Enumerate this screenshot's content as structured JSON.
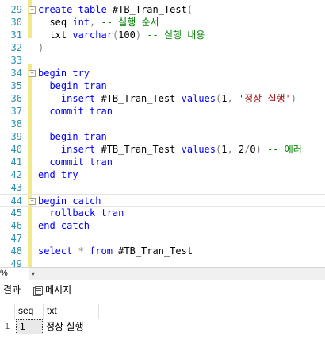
{
  "editor": {
    "lines": [
      {
        "num": "29",
        "tokens": [
          [
            "kw",
            "create table "
          ],
          [
            "",
            "#TB_Tran_Test"
          ],
          [
            "gr",
            "("
          ]
        ]
      },
      {
        "num": "30",
        "tokens": [
          [
            "",
            "  seq "
          ],
          [
            "kw",
            "int"
          ],
          [
            "gr",
            ", "
          ],
          [
            "cm",
            "-- 실행 순서"
          ]
        ]
      },
      {
        "num": "31",
        "tokens": [
          [
            "",
            "  txt "
          ],
          [
            "kw",
            "varchar"
          ],
          [
            "gr",
            "("
          ],
          [
            "",
            "100"
          ],
          [
            "gr",
            ") "
          ],
          [
            "cm",
            "-- 실행 내용"
          ]
        ]
      },
      {
        "num": "32",
        "tokens": [
          [
            "gr",
            ")"
          ]
        ]
      },
      {
        "num": "33",
        "tokens": []
      },
      {
        "num": "34",
        "tokens": [
          [
            "kw",
            "begin try"
          ]
        ]
      },
      {
        "num": "35",
        "tokens": [
          [
            "kw",
            "  begin tran"
          ]
        ]
      },
      {
        "num": "36",
        "tokens": [
          [
            "kw",
            "    insert "
          ],
          [
            "",
            "#TB_Tran_Test "
          ],
          [
            "kw",
            "values"
          ],
          [
            "gr",
            "("
          ],
          [
            "",
            "1"
          ],
          [
            "gr",
            ", "
          ],
          [
            "str",
            "'정상 실행'"
          ],
          [
            "gr",
            ")"
          ]
        ]
      },
      {
        "num": "37",
        "tokens": [
          [
            "kw",
            "  commit tran"
          ]
        ]
      },
      {
        "num": "38",
        "tokens": []
      },
      {
        "num": "39",
        "tokens": [
          [
            "kw",
            "  begin tran"
          ]
        ]
      },
      {
        "num": "40",
        "tokens": [
          [
            "kw",
            "    insert "
          ],
          [
            "",
            "#TB_Tran_Test "
          ],
          [
            "kw",
            "values"
          ],
          [
            "gr",
            "("
          ],
          [
            "",
            "1"
          ],
          [
            "gr",
            ", "
          ],
          [
            "",
            "2"
          ],
          [
            "gr",
            "/"
          ],
          [
            "",
            "0"
          ],
          [
            "gr",
            ") "
          ],
          [
            "cm",
            "-- 에러"
          ]
        ]
      },
      {
        "num": "41",
        "tokens": [
          [
            "kw",
            "  commit tran"
          ]
        ]
      },
      {
        "num": "42",
        "tokens": [
          [
            "kw",
            "end try"
          ]
        ]
      },
      {
        "num": "43",
        "tokens": []
      },
      {
        "num": "44",
        "tokens": [
          [
            "kw",
            "begin catch"
          ]
        ]
      },
      {
        "num": "45",
        "tokens": [
          [
            "kw",
            "  rollback tran"
          ]
        ]
      },
      {
        "num": "46",
        "tokens": [
          [
            "kw",
            "end catch"
          ]
        ]
      },
      {
        "num": "47",
        "tokens": []
      },
      {
        "num": "48",
        "tokens": [
          [
            "kw",
            "select "
          ],
          [
            "gr",
            "* "
          ],
          [
            "kw",
            "from "
          ],
          [
            "",
            "#TB_Tran_Test"
          ]
        ]
      },
      {
        "num": "49",
        "tokens": []
      }
    ]
  },
  "zoom": {
    "value": "%",
    "arrow": "▾"
  },
  "tabs": {
    "results": "결과",
    "messages": "메시지"
  },
  "results": {
    "columns": [
      "seq",
      "txt"
    ],
    "rows": [
      {
        "row_num": "1",
        "seq": "1",
        "txt": "정상 실행"
      }
    ]
  }
}
